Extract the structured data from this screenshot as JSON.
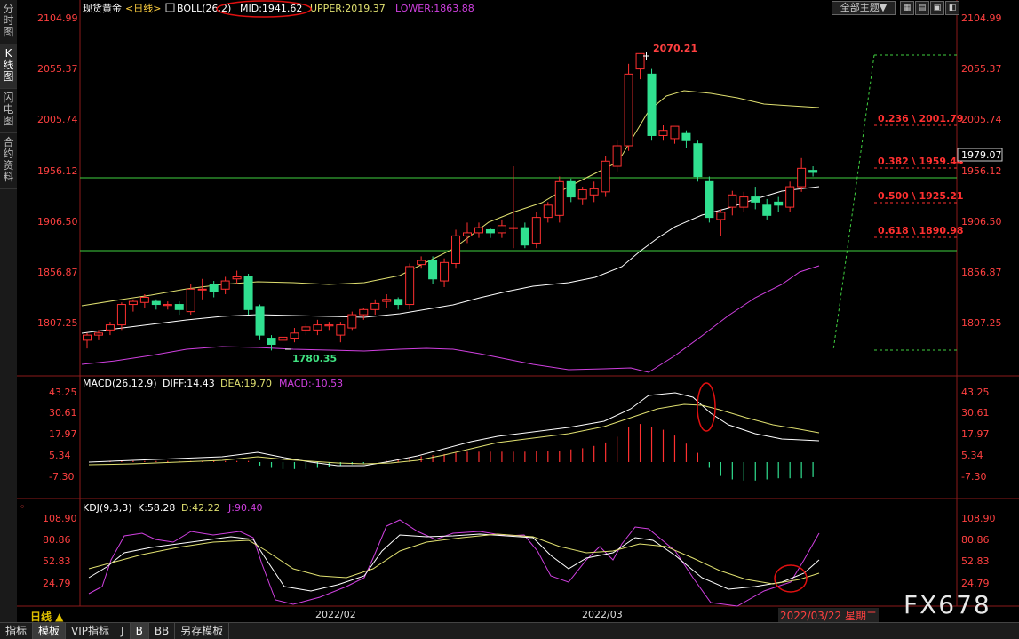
{
  "left_tabs": [
    "分时图",
    "K线图",
    "闪电图",
    "合约资料"
  ],
  "toolbar": {
    "theme_label": "全部主题",
    "theme_arrow": "▼"
  },
  "main_header": {
    "name": "现货黄金",
    "period": "<日线>",
    "boll": "BOLL(26,2)",
    "mid": "MID:1941.62",
    "upper": "UPPER:2019.37",
    "lower": "LOWER:1863.88"
  },
  "price_axis": [
    "2104.99",
    "2055.37",
    "2005.74",
    "1956.12",
    "1906.50",
    "1856.87",
    "1807.25"
  ],
  "current_price": "1979.07",
  "annotations": {
    "high": "2070.21",
    "low": "1780.35"
  },
  "fib_levels": [
    "0.236 \\ 2001.79",
    "0.382 \\ 1959.44",
    "0.500 \\ 1925.21",
    "0.618 \\ 1890.98"
  ],
  "macd_header": {
    "name": "MACD(26,12,9)",
    "diff": "DIFF:14.43",
    "dea": "DEA:19.70",
    "macd": "MACD:-10.53"
  },
  "macd_axis": [
    "43.25",
    "30.61",
    "17.97",
    "5.34",
    "-7.30"
  ],
  "kdj_header": {
    "name": "KDJ(9,3,3)",
    "k": "K:58.28",
    "d": "D:42.22",
    "j": "J:90.40"
  },
  "kdj_axis": [
    "108.90",
    "80.86",
    "52.83",
    "24.79"
  ],
  "x_axis": [
    "2022/02",
    "2022/03"
  ],
  "date_label": "2022/03/22 星期二",
  "daily_label": "日线 ▲",
  "bottom_tabs": [
    "指标",
    "模板",
    "VIP指标",
    "J",
    "B",
    "BB",
    "另存模板"
  ],
  "watermark": "FX678",
  "colors": {
    "up": "#ff3030",
    "down": "#30e090",
    "boll_mid": "#ffffff",
    "boll_upper": "#e0e070",
    "boll_lower": "#d040e0",
    "fib": "#ff3030",
    "hline": "#40d040",
    "axis_text": "#ff4040"
  },
  "chart_data": {
    "type": "candlestick",
    "price_range": [
      1760,
      2110
    ],
    "candles": [
      [
        1790,
        1795,
        1782,
        1797
      ],
      [
        1795,
        1797,
        1790,
        1800
      ],
      [
        1800,
        1805,
        1795,
        1808
      ],
      [
        1805,
        1825,
        1800,
        1827
      ],
      [
        1825,
        1828,
        1818,
        1830
      ],
      [
        1827,
        1832,
        1822,
        1835
      ],
      [
        1828,
        1825,
        1820,
        1830
      ],
      [
        1824,
        1825,
        1820,
        1828
      ],
      [
        1825,
        1820,
        1815,
        1828
      ],
      [
        1818,
        1840,
        1815,
        1845
      ],
      [
        1840,
        1840,
        1830,
        1850
      ],
      [
        1845,
        1838,
        1832,
        1848
      ],
      [
        1840,
        1848,
        1835,
        1852
      ],
      [
        1850,
        1852,
        1845,
        1858
      ],
      [
        1852,
        1820,
        1815,
        1855
      ],
      [
        1823,
        1795,
        1790,
        1825
      ],
      [
        1792,
        1786,
        1780,
        1795
      ],
      [
        1790,
        1793,
        1786,
        1797
      ],
      [
        1792,
        1797,
        1788,
        1802
      ],
      [
        1800,
        1803,
        1795,
        1806
      ],
      [
        1800,
        1805,
        1795,
        1810
      ],
      [
        1804,
        1805,
        1800,
        1808
      ],
      [
        1795,
        1805,
        1788,
        1808
      ],
      [
        1802,
        1815,
        1800,
        1818
      ],
      [
        1815,
        1820,
        1810,
        1822
      ],
      [
        1820,
        1826,
        1815,
        1830
      ],
      [
        1828,
        1830,
        1822,
        1835
      ],
      [
        1830,
        1825,
        1820,
        1832
      ],
      [
        1825,
        1862,
        1820,
        1865
      ],
      [
        1864,
        1868,
        1860,
        1872
      ],
      [
        1868,
        1850,
        1845,
        1872
      ],
      [
        1848,
        1866,
        1842,
        1870
      ],
      [
        1865,
        1892,
        1860,
        1898
      ],
      [
        1892,
        1895,
        1885,
        1905
      ],
      [
        1895,
        1900,
        1890,
        1905
      ],
      [
        1898,
        1895,
        1890,
        1900
      ],
      [
        1895,
        1902,
        1890,
        1908
      ],
      [
        1900,
        1900,
        1880,
        1960
      ],
      [
        1900,
        1883,
        1880,
        1905
      ],
      [
        1885,
        1910,
        1880,
        1915
      ],
      [
        1910,
        1922,
        1905,
        1925
      ],
      [
        1912,
        1945,
        1905,
        1950
      ],
      [
        1945,
        1930,
        1925,
        1948
      ],
      [
        1928,
        1937,
        1922,
        1940
      ],
      [
        1932,
        1938,
        1925,
        1945
      ],
      [
        1935,
        1965,
        1930,
        1970
      ],
      [
        1960,
        1980,
        1955,
        1985
      ],
      [
        1980,
        2050,
        1975,
        2060
      ],
      [
        2055,
        2070,
        2045,
        2070
      ],
      [
        2050,
        1990,
        1985,
        2055
      ],
      [
        1990,
        1995,
        1985,
        2000
      ],
      [
        1987,
        1999,
        1982,
        1999
      ],
      [
        1992,
        1985,
        1978,
        1995
      ],
      [
        1982,
        1950,
        1945,
        1985
      ],
      [
        1945,
        1910,
        1905,
        1950
      ],
      [
        1908,
        1915,
        1892,
        1918
      ],
      [
        1920,
        1932,
        1912,
        1936
      ],
      [
        1920,
        1930,
        1915,
        1935
      ],
      [
        1930,
        1925,
        1918,
        1940
      ],
      [
        1922,
        1912,
        1908,
        1928
      ],
      [
        1925,
        1922,
        1915,
        1930
      ],
      [
        1920,
        1940,
        1915,
        1945
      ],
      [
        1940,
        1958,
        1935,
        1968
      ],
      [
        1956,
        1954,
        1950,
        1960
      ]
    ]
  }
}
